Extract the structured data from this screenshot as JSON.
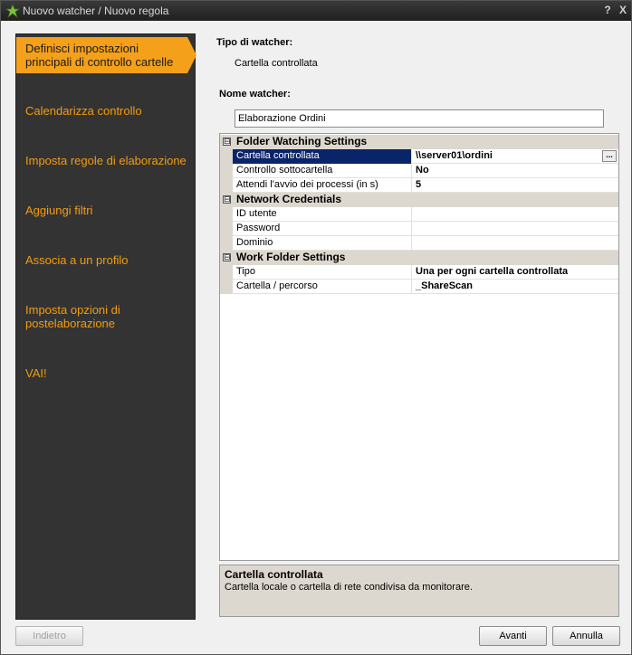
{
  "window": {
    "title": "Nuovo watcher / Nuovo regola",
    "help_label": "?",
    "close_label": "X"
  },
  "sidebar": {
    "items": [
      {
        "label": "Definisci impostazioni principali di controllo cartelle",
        "active": true
      },
      {
        "label": "Calendarizza controllo"
      },
      {
        "label": "Imposta regole di elaborazione"
      },
      {
        "label": "Aggiungi filtri"
      },
      {
        "label": "Associa a un profilo"
      },
      {
        "label": "Imposta opzioni di postelaborazione"
      },
      {
        "label": "VAI!"
      }
    ]
  },
  "form": {
    "watcher_type_label": "Tipo di watcher:",
    "watcher_type_value": "Cartella controllata",
    "name_label": "Nome watcher:",
    "name_value": "Elaborazione Ordini"
  },
  "property_grid": {
    "categories": [
      {
        "name": "Folder Watching Settings",
        "toggle": "⊟",
        "properties": [
          {
            "name": "Cartella controllata",
            "value": "\\\\server01\\ordini",
            "selected": true
          },
          {
            "name": "Controllo sottocartella",
            "value": "No"
          },
          {
            "name": "Attendi l'avvio dei processi (in s)",
            "value": "5"
          }
        ]
      },
      {
        "name": "Network Credentials",
        "toggle": "⊟",
        "properties": [
          {
            "name": "ID utente",
            "value": ""
          },
          {
            "name": "Password",
            "value": ""
          },
          {
            "name": "Dominio",
            "value": ""
          }
        ]
      },
      {
        "name": "Work Folder Settings",
        "toggle": "⊟",
        "properties": [
          {
            "name": "Tipo",
            "value": "Una per ogni cartella controllata"
          },
          {
            "name": "Cartella / percorso",
            "value": "_ShareScan"
          }
        ]
      }
    ],
    "ellipsis_label": "..."
  },
  "description": {
    "title": "Cartella controllata",
    "text": "Cartella locale o cartella di rete condivisa da monitorare."
  },
  "buttons": {
    "back": "Indietro",
    "next": "Avanti",
    "cancel": "Annulla"
  },
  "colors": {
    "accent": "#f5a01a",
    "sidebar_bg": "#333333",
    "selection": "#0a246a"
  }
}
